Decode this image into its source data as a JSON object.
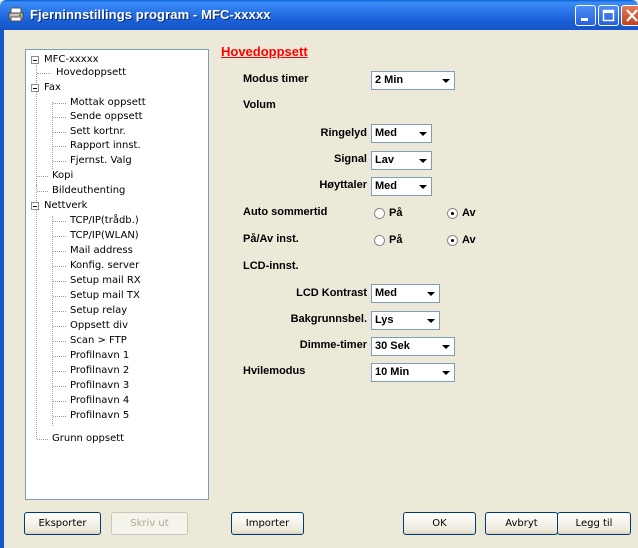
{
  "window": {
    "title": "Fjerninnstillings program - MFC-xxxxx"
  },
  "tree": {
    "root": "MFC-xxxxx",
    "items": {
      "hovedoppsett": "Hovedoppsett",
      "fax": "Fax",
      "mottak": "Mottak oppsett",
      "sende": "Sende oppsett",
      "sett": "Sett kortnr.",
      "rapport": "Rapport innst.",
      "fjernst": "Fjernst. Valg",
      "kopi": "Kopi",
      "bilde": "Bildeuthenting",
      "nettverk": "Nettverk",
      "tcpwire": "TCP/IP(trådb.)",
      "tcpwlan": "TCP/IP(WLAN)",
      "mail": "Mail address",
      "konfig": "Konfig. server",
      "rx": "Setup mail RX",
      "tx": "Setup mail TX",
      "relay": "Setup relay",
      "div": "Oppsett div",
      "scan": "Scan > FTP",
      "p1": "Profilnavn 1",
      "p2": "Profilnavn 2",
      "p3": "Profilnavn 3",
      "p4": "Profilnavn 4",
      "p5": "Profilnavn 5",
      "grunn": "Grunn oppsett"
    }
  },
  "main": {
    "section_title": "Hovedoppsett",
    "modus_timer": {
      "label": "Modus timer",
      "value": "2 Min"
    },
    "volum": {
      "label": "Volum"
    },
    "ringelyd": {
      "label": "Ringelyd",
      "value": "Med"
    },
    "signal": {
      "label": "Signal",
      "value": "Lav"
    },
    "hoyttaler": {
      "label": "Høyttaler",
      "value": "Med"
    },
    "auto_sommertid": {
      "label": "Auto sommertid",
      "on": "På",
      "off": "Av",
      "selected": "off"
    },
    "paav": {
      "label": "På/Av inst.",
      "on": "På",
      "off": "Av",
      "selected": "off"
    },
    "lcd": {
      "label": "LCD-innst."
    },
    "lcd_kontrast": {
      "label": "LCD Kontrast",
      "value": "Med"
    },
    "bakgrunn": {
      "label": "Bakgrunnsbel.",
      "value": "Lys"
    },
    "dimme": {
      "label": "Dimme-timer",
      "value": "30 Sek"
    },
    "hvilemodus": {
      "label": "Hvilemodus",
      "value": "10 Min"
    }
  },
  "buttons": {
    "eksporter": "Eksporter",
    "skriv_ut": "Skriv ut",
    "importer": "Importer",
    "ok": "OK",
    "avbryt": "Avbryt",
    "legg_til": "Legg til"
  }
}
